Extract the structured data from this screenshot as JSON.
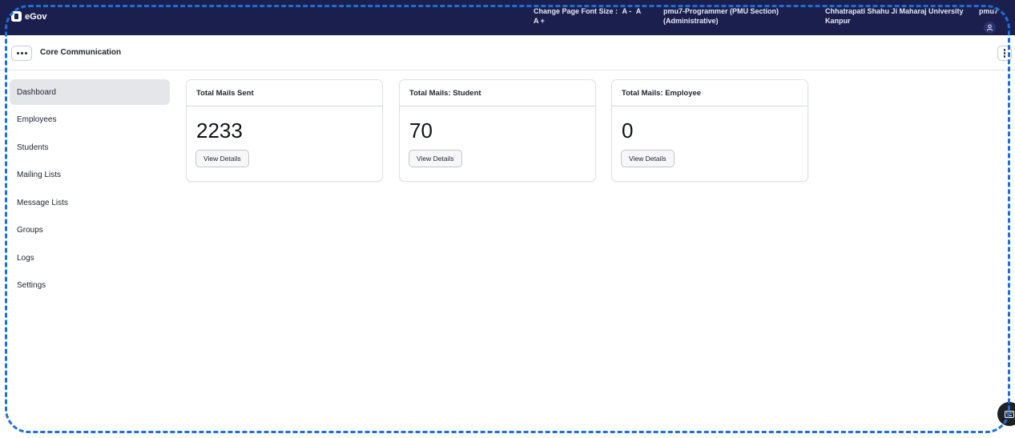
{
  "header": {
    "brand": "eGov",
    "font_size_label": "Change Page Font Size :",
    "font_decrease": "A -",
    "font_normal": "A",
    "font_increase": "A +",
    "role_line1": "pmu7-Programmer (PMU Section)",
    "role_line2": "(Administrative)",
    "university_line1": "Chhatrapati Shahu Ji Maharaj University",
    "university_line2": "Kanpur",
    "username": "pmu7"
  },
  "subheader": {
    "module_title": "Core Communication"
  },
  "sidebar": {
    "items": [
      {
        "label": "Dashboard",
        "active": true
      },
      {
        "label": "Employees"
      },
      {
        "label": "Students"
      },
      {
        "label": "Mailing Lists"
      },
      {
        "label": "Message Lists"
      },
      {
        "label": "Groups"
      },
      {
        "label": "Logs"
      },
      {
        "label": "Settings"
      }
    ]
  },
  "cards": [
    {
      "title": "Total Mails Sent",
      "value": "2233",
      "button": "View Details"
    },
    {
      "title": "Total Mails: Student",
      "value": "70",
      "button": "View Details"
    },
    {
      "title": "Total Mails: Employee",
      "value": "0",
      "button": "View Details"
    }
  ],
  "colors": {
    "topbar": "#1b1f4d",
    "active_item": "#e5e6ea",
    "selection_frame": "#1d6fd8"
  }
}
